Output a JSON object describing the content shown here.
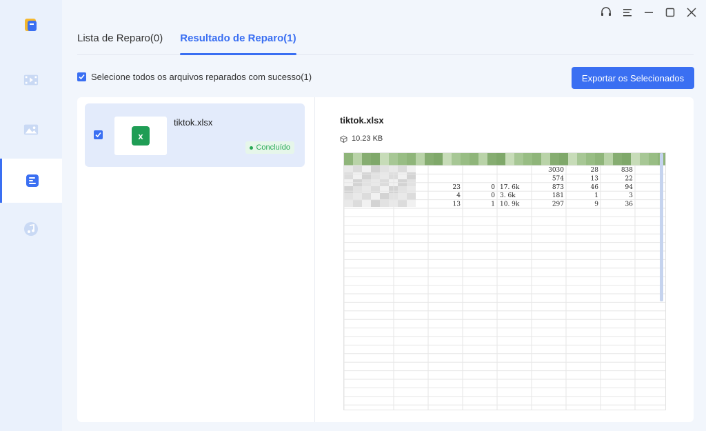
{
  "tabs": [
    {
      "label": "Lista de Reparo(0)"
    },
    {
      "label": "Resultado de Reparo(1)"
    }
  ],
  "select_all": {
    "label": "Selecione todos os arquivos reparados com sucesso(1)",
    "checked": true
  },
  "export_button": {
    "label": "Exportar os Selecionados"
  },
  "file": {
    "name": "tiktok.xlsx",
    "icon_letter": "x",
    "status": "Concluído"
  },
  "preview": {
    "title": "tiktok.xlsx",
    "size": "10.23 KB",
    "rows": [
      [
        "",
        "",
        "",
        "",
        "3030",
        "28",
        "838"
      ],
      [
        "",
        "",
        "",
        "",
        "574",
        "13",
        "22"
      ],
      [
        "",
        "23",
        "0",
        "17. 6k",
        "873",
        "46",
        "94"
      ],
      [
        "",
        "4",
        "0",
        "3. 6k",
        "181",
        "1",
        "3"
      ],
      [
        "",
        "13",
        "1",
        "10. 9k",
        "297",
        "9",
        "36"
      ]
    ]
  },
  "colors": {
    "accent": "#3a6ff2",
    "success": "#27a955",
    "excel": "#1f9d55"
  }
}
